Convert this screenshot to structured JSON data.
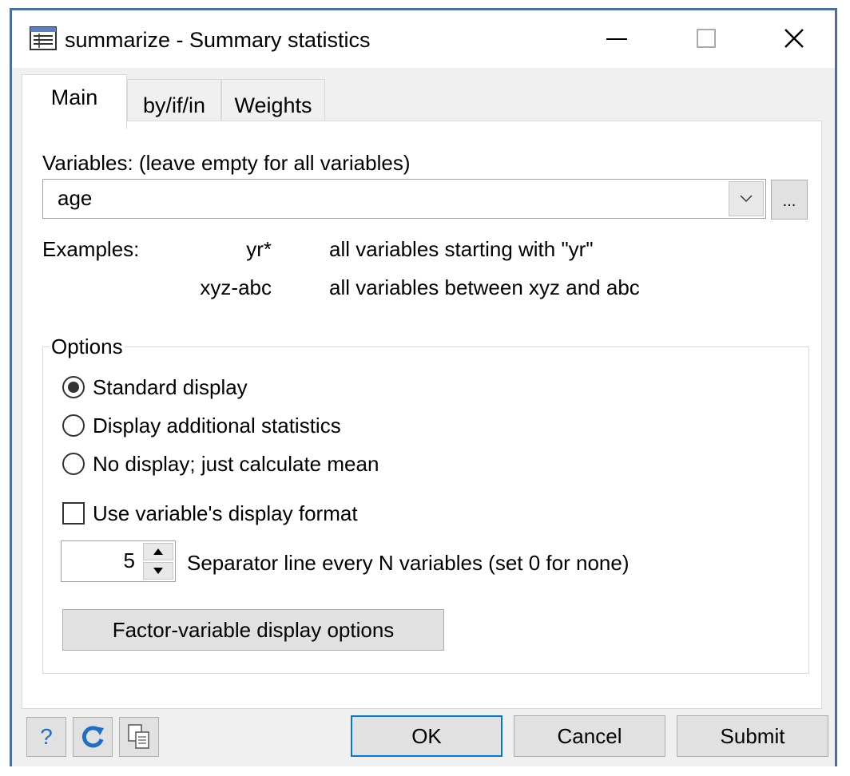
{
  "window": {
    "title": "summarize - Summary statistics"
  },
  "tabs": [
    {
      "label": "Main",
      "selected": true
    },
    {
      "label": "by/if/in",
      "selected": false
    },
    {
      "label": "Weights",
      "selected": false
    }
  ],
  "variables": {
    "label": "Variables: (leave empty for all variables)",
    "value": "age",
    "browse_label": "..."
  },
  "examples": {
    "label": "Examples:",
    "rows": [
      {
        "pattern": "yr*",
        "description": "all variables starting with \"yr\""
      },
      {
        "pattern": "xyz-abc",
        "description": "all variables between xyz and abc"
      }
    ]
  },
  "options": {
    "legend": "Options",
    "radios": [
      {
        "label": "Standard display",
        "checked": true
      },
      {
        "label": "Display additional statistics",
        "checked": false
      },
      {
        "label": "No display; just calculate mean",
        "checked": false
      }
    ],
    "checkbox": {
      "label": "Use variable's display format",
      "checked": false
    },
    "separator": {
      "value": "5",
      "label": "Separator line every N variables (set 0 for none)"
    },
    "fv_button": "Factor-variable display options"
  },
  "footer": {
    "help_label": "?",
    "ok_label": "OK",
    "cancel_label": "Cancel",
    "submit_label": "Submit"
  },
  "colors": {
    "window_border": "#4a6fa5",
    "dialog_bg": "#f0f0f0",
    "default_button_border": "#0078d7",
    "icon_blue": "#1f6fc5"
  }
}
